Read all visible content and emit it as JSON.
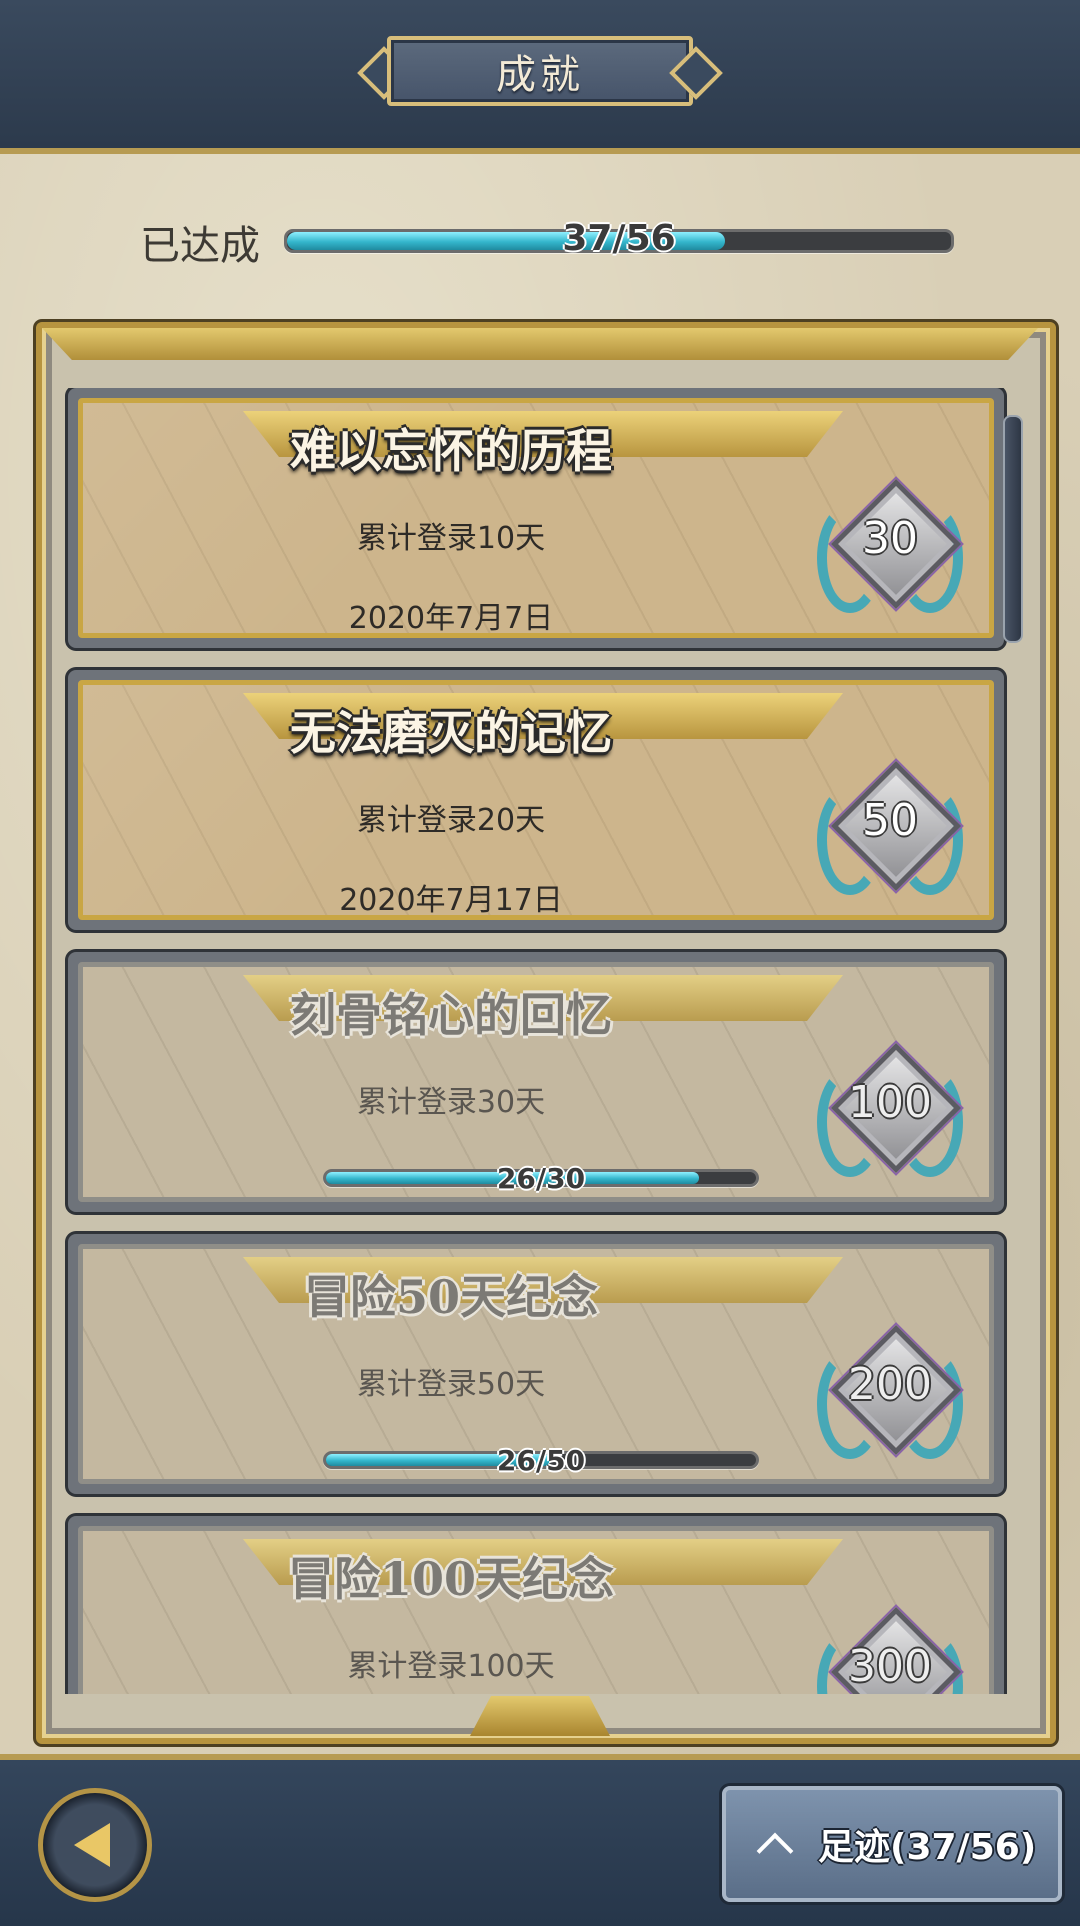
{
  "header": {
    "title": "成就"
  },
  "overall": {
    "label": "已达成",
    "progress_text": "37/56",
    "progress_fraction": 0.66
  },
  "achievements": [
    {
      "title": "难以忘怀的历程",
      "description": "累计登录10天",
      "date": "2020年7月7日",
      "reward": "30",
      "completed": true
    },
    {
      "title": "无法磨灭的记忆",
      "description": "累计登录20天",
      "date": "2020年7月17日",
      "reward": "50",
      "completed": true
    },
    {
      "title": "刻骨铭心的回忆",
      "description": "累计登录30天",
      "progress_text": "26/30",
      "progress_fraction": 0.8667,
      "reward": "100",
      "completed": false
    },
    {
      "title": "冒险50天纪念",
      "description": "累计登录50天",
      "progress_text": "26/50",
      "progress_fraction": 0.52,
      "reward": "200",
      "completed": false
    },
    {
      "title": "冒险100天纪念",
      "description": "累计登录100天",
      "reward": "300",
      "completed": false
    }
  ],
  "footer": {
    "footprint_label": "足迹(37/56)"
  },
  "icons": {
    "back": "back-arrow-icon",
    "expand": "chevron-up-icon",
    "badge": "laurel-diamond-badge-icon"
  },
  "colors": {
    "progress_fill": "#34b6cc",
    "gold_frame": "#c9a644",
    "header_bg": "#3a4a5e"
  }
}
